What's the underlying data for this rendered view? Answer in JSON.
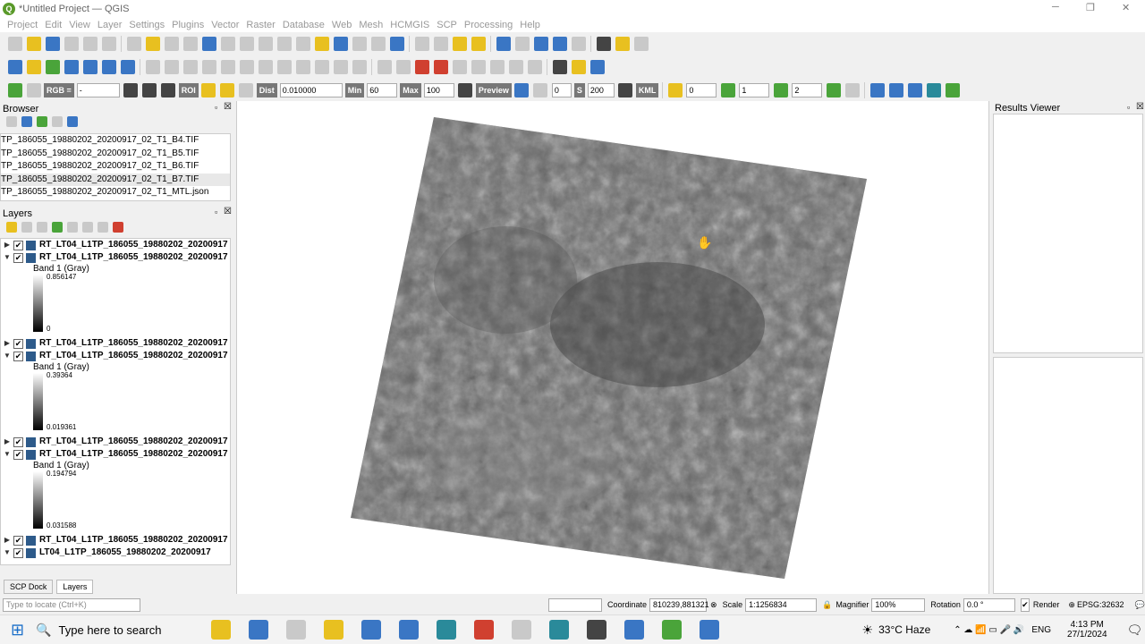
{
  "window": {
    "title": "*Untitled Project — QGIS"
  },
  "menu": [
    "Project",
    "Edit",
    "View",
    "Layer",
    "Settings",
    "Plugins",
    "Vector",
    "Raster",
    "Database",
    "Web",
    "Mesh",
    "HCMGIS",
    "SCP",
    "Processing",
    "Help"
  ],
  "scp_toolbar": {
    "rgb_label": "RGB =",
    "rgb_value": "-",
    "roi_label": "ROI",
    "dist_label": "Dist",
    "dist_value": "0.010000",
    "min_label": "Min",
    "min_value": "60",
    "max_label": "Max",
    "max_value": "100",
    "preview_label": "Preview",
    "t_value": "0",
    "s_label": "S",
    "s_value": "200",
    "kml_label": "KML",
    "field1": "0",
    "field2": "1",
    "field3": "2"
  },
  "browser": {
    "title": "Browser",
    "items": [
      "TP_186055_19880202_20200917_02_T1_B4.TIF",
      "TP_186055_19880202_20200917_02_T1_B5.TIF",
      "TP_186055_19880202_20200917_02_T1_B6.TIF",
      "TP_186055_19880202_20200917_02_T1_B7.TIF",
      "TP_186055_19880202_20200917_02_T1_MTL.json"
    ]
  },
  "layers": {
    "title": "Layers",
    "rows": [
      {
        "name": "RT_LT04_L1TP_186055_19880202_20200917",
        "expanded": false
      },
      {
        "name": "RT_LT04_L1TP_186055_19880202_20200917",
        "expanded": true,
        "band": "Band 1 (Gray)",
        "max": "0.856147",
        "min": "0"
      },
      {
        "name": "RT_LT04_L1TP_186055_19880202_20200917",
        "expanded": false
      },
      {
        "name": "RT_LT04_L1TP_186055_19880202_20200917",
        "expanded": true,
        "band": "Band 1 (Gray)",
        "max": "0.39364",
        "min": "0.019361"
      },
      {
        "name": "RT_LT04_L1TP_186055_19880202_20200917",
        "expanded": false
      },
      {
        "name": "RT_LT04_L1TP_186055_19880202_20200917",
        "expanded": true,
        "band": "Band 1 (Gray)",
        "max": "0.194794",
        "min": "0.031588"
      },
      {
        "name": "RT_LT04_L1TP_186055_19880202_20200917",
        "expanded": false
      },
      {
        "name": "LT04_L1TP_186055_19880202_20200917",
        "expanded": false
      }
    ]
  },
  "dock_tabs": [
    "SCP Dock",
    "Layers"
  ],
  "results_viewer": {
    "title": "Results Viewer"
  },
  "statusbar": {
    "locate_placeholder": "Type to locate (Ctrl+K)",
    "coordinate_label": "Coordinate",
    "coordinate_value": "810239,881321",
    "scale_label": "Scale",
    "scale_value": "1:1256834",
    "magnifier_label": "Magnifier",
    "magnifier_value": "100%",
    "rotation_label": "Rotation",
    "rotation_value": "0.0 °",
    "render_label": "Render",
    "crs_label": "EPSG:32632"
  },
  "taskbar": {
    "search_placeholder": "Type here to search",
    "weather": "33°C  Haze",
    "language": "ENG",
    "time": "4:13 PM",
    "date": "27/1/2024"
  }
}
